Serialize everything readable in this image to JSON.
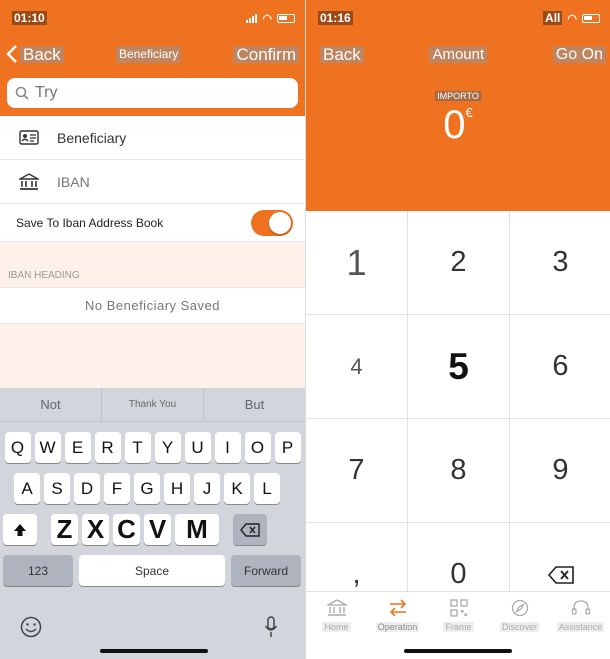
{
  "left": {
    "status": {
      "time": "01:10"
    },
    "nav": {
      "back_label": "Back",
      "title": "Beneficiary",
      "confirm_label": "Confirm"
    },
    "search": {
      "placeholder": "Try"
    },
    "fields": {
      "beneficiary_label": "Beneficiary",
      "iban_placeholder": "IBAN"
    },
    "save_toggle": {
      "label": "Save To Iban Address Book",
      "on": true
    },
    "section": {
      "heading": "IBAN HEADING",
      "empty_text": "No Beneficiary Saved"
    },
    "keyboard": {
      "suggestions": [
        "Not",
        "Thank You",
        "But"
      ],
      "row1": [
        "Q",
        "W",
        "E",
        "R",
        "T",
        "Y",
        "U",
        "I",
        "O",
        "P"
      ],
      "row2": [
        "A",
        "S",
        "D",
        "F",
        "G",
        "H",
        "J",
        "K",
        "L"
      ],
      "row3": [
        "Z",
        "X",
        "C",
        "V",
        "M"
      ],
      "numbers_key": "123",
      "space_key": "Space",
      "return_key": "Forward",
      "icons": [
        "shift-icon",
        "backspace-icon",
        "emoji-icon",
        "microphone-icon"
      ]
    }
  },
  "right": {
    "status": {
      "time": "01:16",
      "carrier": "All"
    },
    "nav": {
      "back_label": "Back",
      "title": "Amount",
      "next_label": "Go On"
    },
    "amount": {
      "caption": "IMPORTO",
      "value": "0",
      "currency": "€"
    },
    "keypad": [
      "1",
      "2",
      "3",
      "4",
      "5",
      "6",
      "7",
      "8",
      "9",
      ",",
      "0"
    ],
    "tabs": [
      {
        "label": "Home",
        "icon": "bank-icon"
      },
      {
        "label": "Operation",
        "icon": "transfer-arrows-icon",
        "active": true
      },
      {
        "label": "Frame",
        "icon": "qr-code-icon"
      },
      {
        "label": "Discover",
        "icon": "compass-icon"
      },
      {
        "label": "Assistance",
        "icon": "headset-icon"
      }
    ]
  },
  "colors": {
    "accent": "#ef7220",
    "keyboard_bg": "#d2d5db"
  }
}
